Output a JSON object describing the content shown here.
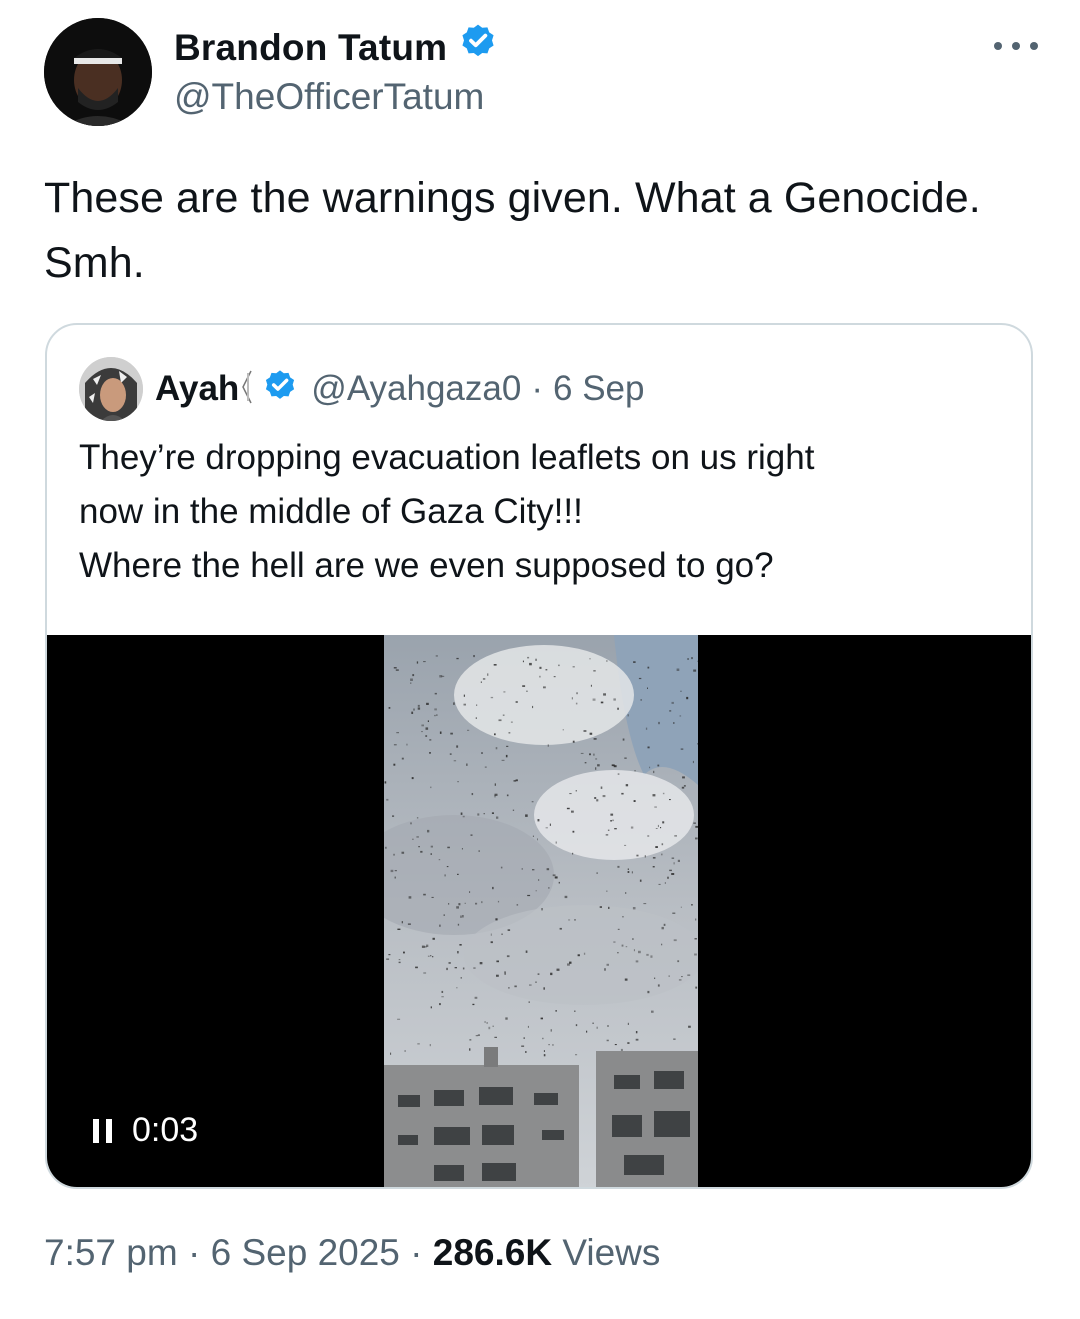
{
  "author": {
    "name": "Brandon Tatum",
    "handle": "@TheOfficerTatum",
    "verified_icon": "verified-badge-icon",
    "avatar_icon": "avatar-photo"
  },
  "menu_icon": "more-options-icon",
  "tweet": {
    "line1": "These are the warnings given. What a Genocide.",
    "line2": "Smh."
  },
  "quoted": {
    "name": "Ayah",
    "flag_icon": "palestine-flag-icon",
    "handle": "@Ayahgaza0",
    "separator": "·",
    "date": "6 Sep",
    "line1": "They’re dropping evacuation leaflets on us right",
    "line2": "now in the middle of Gaza City!!!",
    "line3": "Where the hell are we even supposed to go?",
    "video": {
      "time": "0:03",
      "state_icon": "pause-icon"
    }
  },
  "meta": {
    "time": "7:57 pm",
    "sep1": "·",
    "date": "6 Sep 2025",
    "sep2": "·",
    "views_count": "286.6K",
    "views_label": "Views"
  },
  "colors": {
    "text": "#0f1419",
    "secondary": "#536471",
    "verified": "#1d9bf0",
    "border": "#cfd9de"
  }
}
